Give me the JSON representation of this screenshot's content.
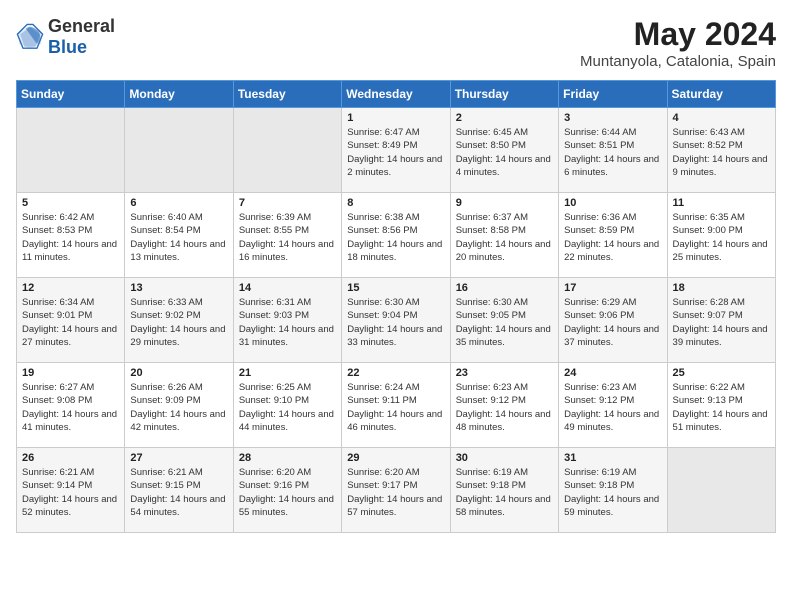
{
  "logo": {
    "general": "General",
    "blue": "Blue"
  },
  "title": "May 2024",
  "location": "Muntanyola, Catalonia, Spain",
  "weekdays": [
    "Sunday",
    "Monday",
    "Tuesday",
    "Wednesday",
    "Thursday",
    "Friday",
    "Saturday"
  ],
  "weeks": [
    [
      {
        "day": "",
        "sunrise": "",
        "sunset": "",
        "daylight": ""
      },
      {
        "day": "",
        "sunrise": "",
        "sunset": "",
        "daylight": ""
      },
      {
        "day": "",
        "sunrise": "",
        "sunset": "",
        "daylight": ""
      },
      {
        "day": "1",
        "sunrise": "Sunrise: 6:47 AM",
        "sunset": "Sunset: 8:49 PM",
        "daylight": "Daylight: 14 hours and 2 minutes."
      },
      {
        "day": "2",
        "sunrise": "Sunrise: 6:45 AM",
        "sunset": "Sunset: 8:50 PM",
        "daylight": "Daylight: 14 hours and 4 minutes."
      },
      {
        "day": "3",
        "sunrise": "Sunrise: 6:44 AM",
        "sunset": "Sunset: 8:51 PM",
        "daylight": "Daylight: 14 hours and 6 minutes."
      },
      {
        "day": "4",
        "sunrise": "Sunrise: 6:43 AM",
        "sunset": "Sunset: 8:52 PM",
        "daylight": "Daylight: 14 hours and 9 minutes."
      }
    ],
    [
      {
        "day": "5",
        "sunrise": "Sunrise: 6:42 AM",
        "sunset": "Sunset: 8:53 PM",
        "daylight": "Daylight: 14 hours and 11 minutes."
      },
      {
        "day": "6",
        "sunrise": "Sunrise: 6:40 AM",
        "sunset": "Sunset: 8:54 PM",
        "daylight": "Daylight: 14 hours and 13 minutes."
      },
      {
        "day": "7",
        "sunrise": "Sunrise: 6:39 AM",
        "sunset": "Sunset: 8:55 PM",
        "daylight": "Daylight: 14 hours and 16 minutes."
      },
      {
        "day": "8",
        "sunrise": "Sunrise: 6:38 AM",
        "sunset": "Sunset: 8:56 PM",
        "daylight": "Daylight: 14 hours and 18 minutes."
      },
      {
        "day": "9",
        "sunrise": "Sunrise: 6:37 AM",
        "sunset": "Sunset: 8:58 PM",
        "daylight": "Daylight: 14 hours and 20 minutes."
      },
      {
        "day": "10",
        "sunrise": "Sunrise: 6:36 AM",
        "sunset": "Sunset: 8:59 PM",
        "daylight": "Daylight: 14 hours and 22 minutes."
      },
      {
        "day": "11",
        "sunrise": "Sunrise: 6:35 AM",
        "sunset": "Sunset: 9:00 PM",
        "daylight": "Daylight: 14 hours and 25 minutes."
      }
    ],
    [
      {
        "day": "12",
        "sunrise": "Sunrise: 6:34 AM",
        "sunset": "Sunset: 9:01 PM",
        "daylight": "Daylight: 14 hours and 27 minutes."
      },
      {
        "day": "13",
        "sunrise": "Sunrise: 6:33 AM",
        "sunset": "Sunset: 9:02 PM",
        "daylight": "Daylight: 14 hours and 29 minutes."
      },
      {
        "day": "14",
        "sunrise": "Sunrise: 6:31 AM",
        "sunset": "Sunset: 9:03 PM",
        "daylight": "Daylight: 14 hours and 31 minutes."
      },
      {
        "day": "15",
        "sunrise": "Sunrise: 6:30 AM",
        "sunset": "Sunset: 9:04 PM",
        "daylight": "Daylight: 14 hours and 33 minutes."
      },
      {
        "day": "16",
        "sunrise": "Sunrise: 6:30 AM",
        "sunset": "Sunset: 9:05 PM",
        "daylight": "Daylight: 14 hours and 35 minutes."
      },
      {
        "day": "17",
        "sunrise": "Sunrise: 6:29 AM",
        "sunset": "Sunset: 9:06 PM",
        "daylight": "Daylight: 14 hours and 37 minutes."
      },
      {
        "day": "18",
        "sunrise": "Sunrise: 6:28 AM",
        "sunset": "Sunset: 9:07 PM",
        "daylight": "Daylight: 14 hours and 39 minutes."
      }
    ],
    [
      {
        "day": "19",
        "sunrise": "Sunrise: 6:27 AM",
        "sunset": "Sunset: 9:08 PM",
        "daylight": "Daylight: 14 hours and 41 minutes."
      },
      {
        "day": "20",
        "sunrise": "Sunrise: 6:26 AM",
        "sunset": "Sunset: 9:09 PM",
        "daylight": "Daylight: 14 hours and 42 minutes."
      },
      {
        "day": "21",
        "sunrise": "Sunrise: 6:25 AM",
        "sunset": "Sunset: 9:10 PM",
        "daylight": "Daylight: 14 hours and 44 minutes."
      },
      {
        "day": "22",
        "sunrise": "Sunrise: 6:24 AM",
        "sunset": "Sunset: 9:11 PM",
        "daylight": "Daylight: 14 hours and 46 minutes."
      },
      {
        "day": "23",
        "sunrise": "Sunrise: 6:23 AM",
        "sunset": "Sunset: 9:12 PM",
        "daylight": "Daylight: 14 hours and 48 minutes."
      },
      {
        "day": "24",
        "sunrise": "Sunrise: 6:23 AM",
        "sunset": "Sunset: 9:12 PM",
        "daylight": "Daylight: 14 hours and 49 minutes."
      },
      {
        "day": "25",
        "sunrise": "Sunrise: 6:22 AM",
        "sunset": "Sunset: 9:13 PM",
        "daylight": "Daylight: 14 hours and 51 minutes."
      }
    ],
    [
      {
        "day": "26",
        "sunrise": "Sunrise: 6:21 AM",
        "sunset": "Sunset: 9:14 PM",
        "daylight": "Daylight: 14 hours and 52 minutes."
      },
      {
        "day": "27",
        "sunrise": "Sunrise: 6:21 AM",
        "sunset": "Sunset: 9:15 PM",
        "daylight": "Daylight: 14 hours and 54 minutes."
      },
      {
        "day": "28",
        "sunrise": "Sunrise: 6:20 AM",
        "sunset": "Sunset: 9:16 PM",
        "daylight": "Daylight: 14 hours and 55 minutes."
      },
      {
        "day": "29",
        "sunrise": "Sunrise: 6:20 AM",
        "sunset": "Sunset: 9:17 PM",
        "daylight": "Daylight: 14 hours and 57 minutes."
      },
      {
        "day": "30",
        "sunrise": "Sunrise: 6:19 AM",
        "sunset": "Sunset: 9:18 PM",
        "daylight": "Daylight: 14 hours and 58 minutes."
      },
      {
        "day": "31",
        "sunrise": "Sunrise: 6:19 AM",
        "sunset": "Sunset: 9:18 PM",
        "daylight": "Daylight: 14 hours and 59 minutes."
      },
      {
        "day": "",
        "sunrise": "",
        "sunset": "",
        "daylight": ""
      }
    ]
  ]
}
